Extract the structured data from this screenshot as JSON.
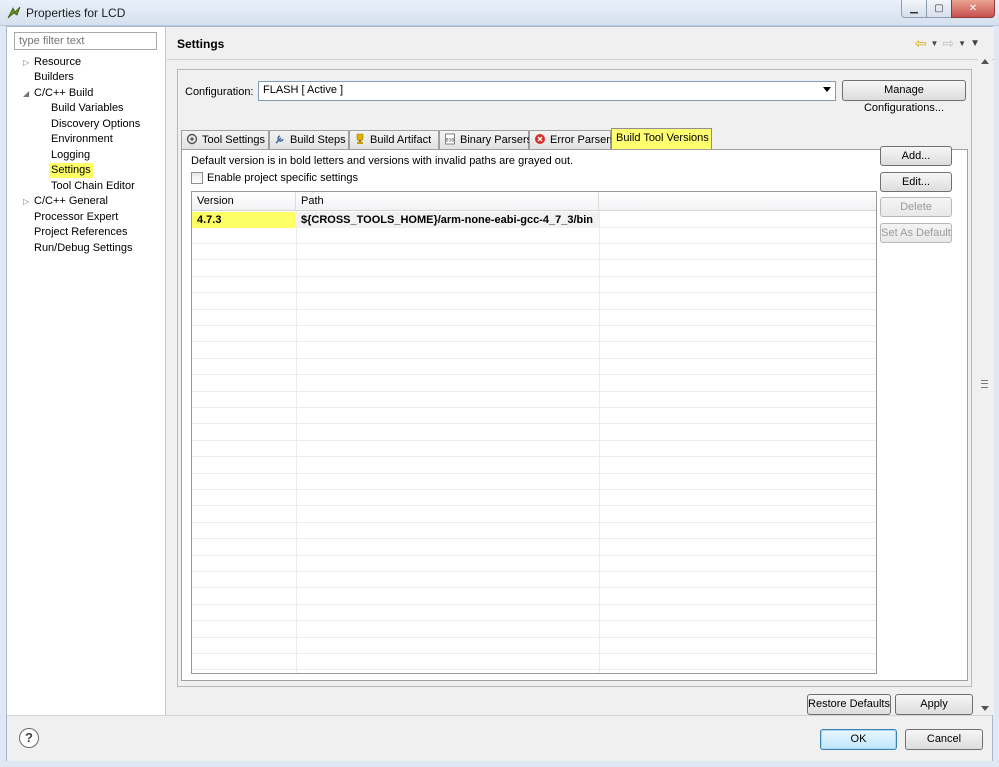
{
  "window": {
    "title": "Properties for LCD"
  },
  "filter": {
    "placeholder": "type filter text"
  },
  "tree": {
    "items": [
      {
        "label": "Resource",
        "arrow": "▷"
      },
      {
        "label": "Builders",
        "arrow": ""
      },
      {
        "label": "C/C++ Build",
        "arrow": "◢"
      },
      {
        "label": "Build Variables",
        "arrow": ""
      },
      {
        "label": "Discovery Options",
        "arrow": ""
      },
      {
        "label": "Environment",
        "arrow": ""
      },
      {
        "label": "Logging",
        "arrow": ""
      },
      {
        "label": "Settings",
        "arrow": ""
      },
      {
        "label": "Tool Chain Editor",
        "arrow": ""
      },
      {
        "label": "C/C++ General",
        "arrow": "▷"
      },
      {
        "label": "Processor Expert",
        "arrow": ""
      },
      {
        "label": "Project References",
        "arrow": ""
      },
      {
        "label": "Run/Debug Settings",
        "arrow": ""
      }
    ]
  },
  "page": {
    "title": "Settings"
  },
  "config": {
    "label": "Configuration:",
    "value": "FLASH  [ Active ]",
    "manage_label": "Manage Configurations..."
  },
  "tabs": [
    {
      "label": "Tool Settings"
    },
    {
      "label": "Build Steps"
    },
    {
      "label": "Build Artifact"
    },
    {
      "label": "Binary Parsers"
    },
    {
      "label": "Error Parsers"
    },
    {
      "label": "Build Tool Versions"
    }
  ],
  "panel": {
    "description": "Default version is in bold letters and versions with invalid paths are grayed out.",
    "checkbox_label": "Enable project specific settings",
    "columns": [
      "Version",
      "Path"
    ],
    "rows": [
      {
        "version": "4.7.3",
        "path": "${CROSS_TOOLS_HOME}/arm-none-eabi-gcc-4_7_3/bin"
      }
    ],
    "buttons": {
      "add": "Add...",
      "edit": "Edit...",
      "delete": "Delete",
      "set_default": "Set As Default"
    }
  },
  "actions": {
    "restore_defaults": "Restore Defaults",
    "apply": "Apply",
    "ok": "OK",
    "cancel": "Cancel",
    "help": "?"
  },
  "colors": {
    "highlight": "#ffff66",
    "selected_tab": "#ffff70"
  }
}
